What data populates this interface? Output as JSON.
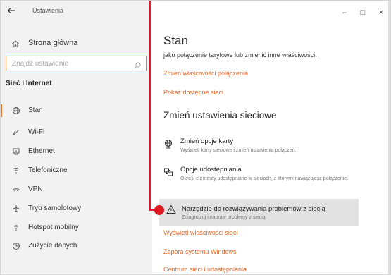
{
  "window": {
    "title": "Ustawienia",
    "back_icon": "back-arrow-icon",
    "minimize": "–",
    "maximize": "□",
    "close": "×"
  },
  "sidebar": {
    "home_label": "Strona główna",
    "search_placeholder": "Znajdź ustawienie",
    "section_title": "Sieć i Internet",
    "items": [
      {
        "label": "Stan",
        "icon": "globe-icon",
        "selected": true
      },
      {
        "label": "Wi-Fi",
        "icon": "wifi-icon"
      },
      {
        "label": "Ethernet",
        "icon": "ethernet-icon"
      },
      {
        "label": "Telefoniczne",
        "icon": "dialup-icon"
      },
      {
        "label": "VPN",
        "icon": "vpn-icon"
      },
      {
        "label": "Tryb samolotowy",
        "icon": "airplane-icon"
      },
      {
        "label": "Hotspot mobilny",
        "icon": "hotspot-icon"
      },
      {
        "label": "Zużycie danych",
        "icon": "data-usage-icon"
      }
    ]
  },
  "main": {
    "title": "Stan",
    "desc": "jako połączenie taryfowe lub zmienić inne właściwości.",
    "link_change_props": "Zmień właściwości połączenia",
    "link_show_networks": "Pokaż dostępne sieci",
    "section_title": "Zmień ustawienia sieciowe",
    "options": [
      {
        "title": "Zmień opcje karty",
        "desc": "Wyświetl karty sieciowe i zmień ustawienia połączeń.",
        "icon": "adapter-icon"
      },
      {
        "title": "Opcje udostępniania",
        "desc": "Określ elementy udostępniane w sieciach, z którymi nawiązujesz połączenie.",
        "icon": "sharing-icon"
      },
      {
        "title": "Narzędzie do rozwiązywania problemów z siecią",
        "desc": "Zdiagnozuj i napraw problemy z siecią.",
        "icon": "warning-icon"
      }
    ],
    "link_view_props": "Wyświetl właściwości sieci",
    "link_firewall": "Zapora systemu Windows",
    "link_network_center": "Centrum sieci i udostępniania"
  },
  "colors": {
    "accent": "#e8672a",
    "annotation": "#e01a22"
  }
}
